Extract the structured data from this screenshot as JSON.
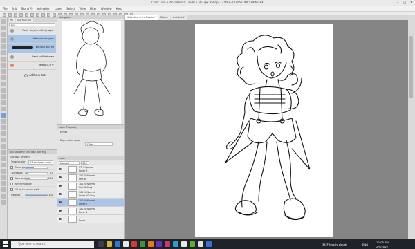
{
  "window": {
    "title": "Color Like A Pro Tutorial* (3500 x 5023px 350dpi 17.9%) - CLIP STUDIO PAINT EX",
    "controls": [
      "–",
      "□",
      "✕"
    ]
  },
  "menu": [
    "File",
    "Edit",
    "Story(P)",
    "Animation",
    "Layer",
    "Select",
    "View",
    "Filter",
    "Window",
    "Help"
  ],
  "subtool": {
    "tabs": [
      "Fill",
      "Sub Tool [Fill]"
    ],
    "filter_value": "Fill",
    "items": [
      {
        "label": "Refer only to editing layer",
        "icon": "fill-dot-icon",
        "selected": false
      },
      {
        "label": "Refer other layers",
        "icon": "fill-dot-icon",
        "selected": true
      },
      {
        "label": "Enclose and fill",
        "icon": "stroke-icon",
        "selected": true
      },
      {
        "label": "Paint unfilled area",
        "icon": "fill-dot-icon",
        "selected": false
      },
      {
        "label": "隙間閉じ塗り",
        "icon": "fill-dot-icon",
        "selected": false
      }
    ],
    "add_label": "Add sub tool"
  },
  "tool_property": {
    "header": "Tool property [Enclose and fill]",
    "title": "Enclose and fill",
    "rows": [
      {
        "key": "Target color",
        "value": "All enclosed areas"
      },
      {
        "key": "Close gap",
        "value": "",
        "level": 0.4
      },
      {
        "key": "Tolerance",
        "value": "10",
        "level": 0.1
      },
      {
        "key": "Area scaling",
        "value": "1.00",
        "level": 0.2
      },
      {
        "key": "Refer multiple",
        "value": ""
      },
      {
        "key": "Fill up to vector path",
        "value": ""
      },
      {
        "key": "Opacity",
        "value": "100",
        "level": 1.0
      }
    ]
  },
  "navigator": {
    "header": "Navigator"
  },
  "layer_property": {
    "header": "Layer Property",
    "effect_label": "Effect",
    "expression_label": "Expression color",
    "expression_value": "Color"
  },
  "layers": {
    "header": "Layer",
    "blend": "Normal",
    "opacity": "100",
    "items": [
      {
        "mode": "57 % Normal",
        "name": "Layer 3",
        "selected": false
      },
      {
        "mode": "100 % Normal",
        "name": "rest of",
        "selected": false
      },
      {
        "mode": "100 % Normal",
        "name": "Hair & Cozy",
        "selected": false
      },
      {
        "mode": "100 % Normal",
        "name": "Layer 10 Copy",
        "selected": false
      },
      {
        "mode": "100 % Normal",
        "name": "Layer 2",
        "selected": true
      },
      {
        "mode": "100 % Normal",
        "name": "Layer 1",
        "selected": false
      },
      {
        "mode": "",
        "name": "Paper",
        "selected": false
      }
    ]
  },
  "canvas": {
    "tabs": [
      "Color Like A Pro Tutorial*",
      "Sketch",
      "Untitled-1*"
    ]
  },
  "taskbar": {
    "search_placeholder": "Type here to search",
    "weather": "34°F  Mostly cloudy",
    "lang": "ENG",
    "time": "12:05 PM",
    "date": "2/9/2022"
  }
}
